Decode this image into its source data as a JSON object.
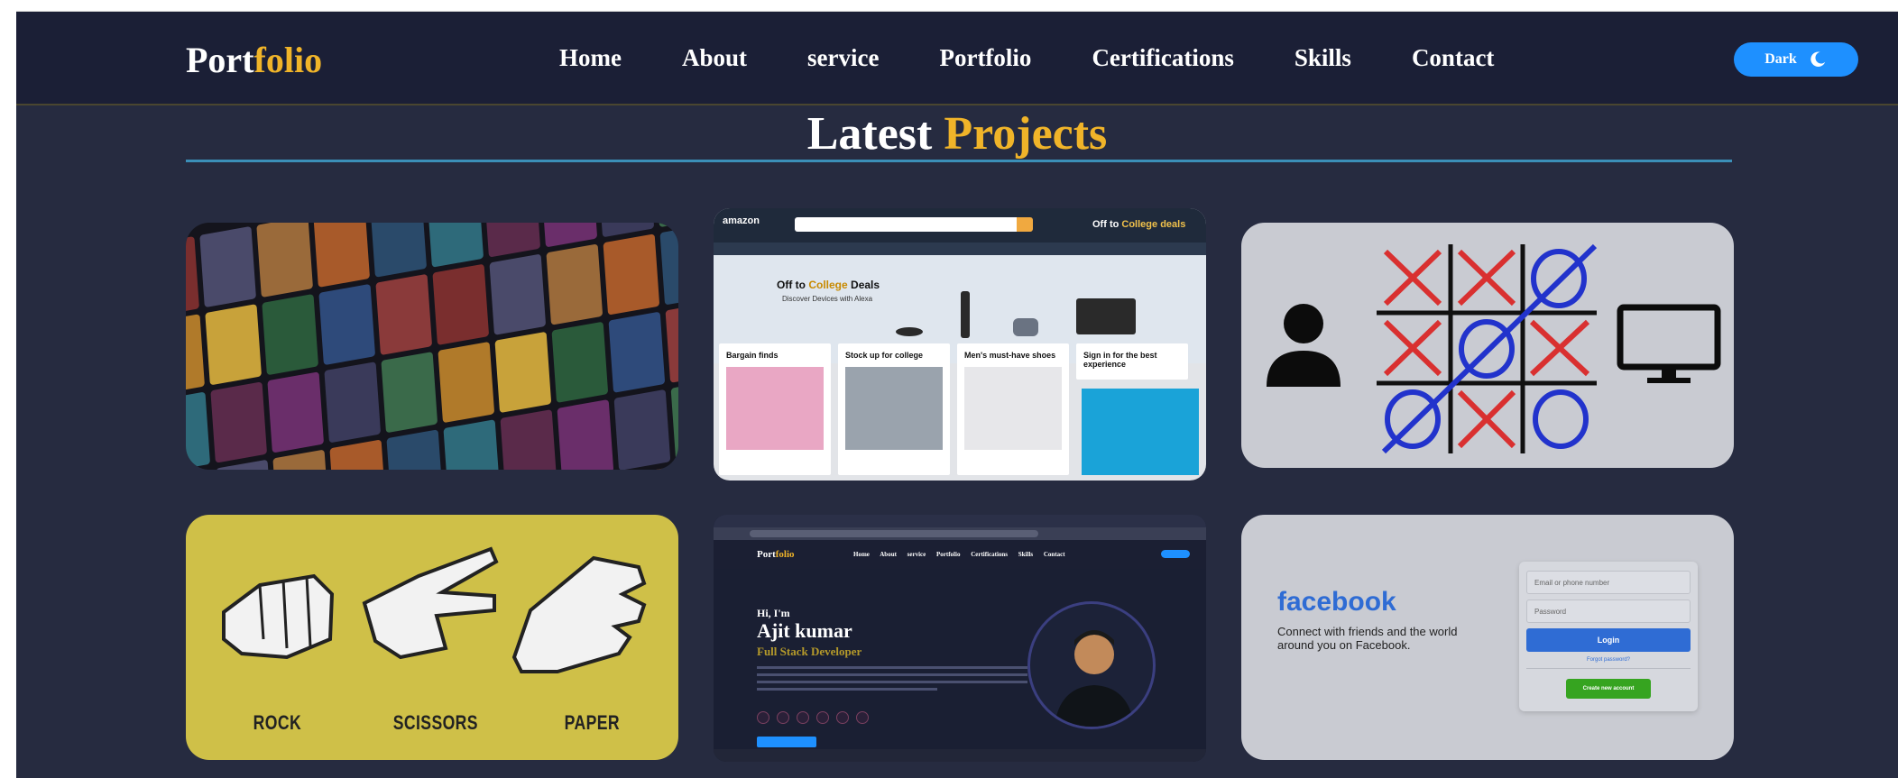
{
  "nav": {
    "logo_main": "Port",
    "logo_accent": "folio",
    "items": [
      {
        "label": "Home"
      },
      {
        "label": "About"
      },
      {
        "label": "service"
      },
      {
        "label": "Portfolio"
      },
      {
        "label": "Certifications"
      },
      {
        "label": "Skills"
      },
      {
        "label": "Contact"
      }
    ],
    "theme_toggle": {
      "label": "Dark",
      "icon": "moon-icon"
    }
  },
  "section": {
    "title_main": "Latest",
    "title_accent": "Projects"
  },
  "projects": {
    "amazon": {
      "logo": "amazon",
      "promo_top": "Off to",
      "promo_top_accent": "College",
      "promo_top_end": "deals",
      "hero_title": "Off to",
      "hero_title_accent": "College",
      "hero_title_end": "Deals",
      "hero_sub": "Discover Devices with Alexa",
      "tiles": [
        "Bargain finds",
        "Stock up for college",
        "Men's must-have shoes",
        "Sign in for the best experience"
      ]
    },
    "rps": {
      "labels": [
        "ROCK",
        "SCISSORS",
        "PAPER"
      ]
    },
    "portfolio": {
      "logo_main": "Port",
      "logo_accent": "folio",
      "menu": "Home About service Portfolio Certifications Skills Contact",
      "greeting": "Hi, I'm",
      "name": "Ajit kumar",
      "role": "Full Stack Developer"
    },
    "facebook": {
      "logo": "facebook",
      "tagline": "Connect with friends and the world around you on Facebook.",
      "email_placeholder": "Email or phone number",
      "password_placeholder": "Password",
      "login_label": "Login",
      "forgot_label": "Forgot password?",
      "create_label": "Create new account"
    }
  },
  "colors": {
    "accent": "#f0b429",
    "background": "#262b40",
    "nav_bg": "#1b1f36",
    "toggle": "#1e90ff",
    "underline": "#3b8fb8"
  }
}
